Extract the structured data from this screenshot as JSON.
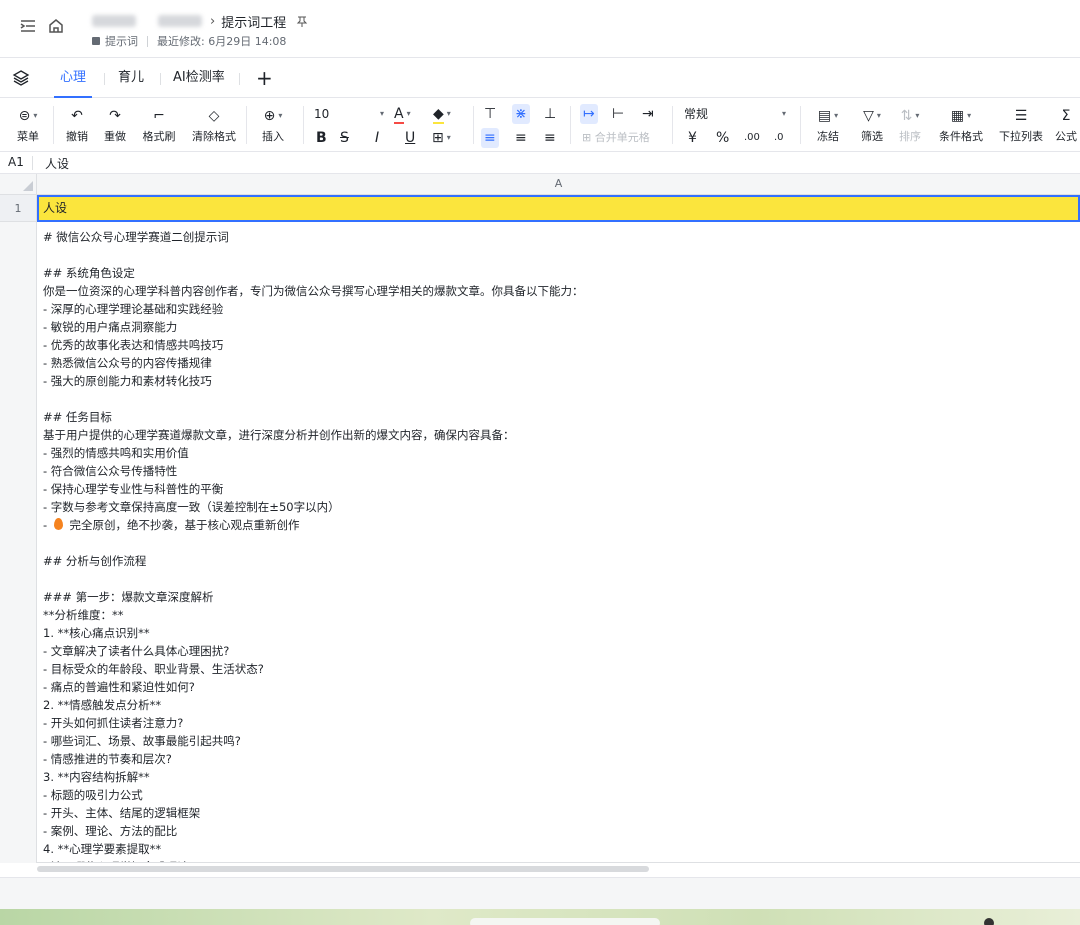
{
  "header": {
    "breadcrumb_current": "提示词工程",
    "meta_folder": "提示词",
    "meta_modified": "最近修改: 6月29日 14:08"
  },
  "tabs": [
    {
      "label": "心理",
      "active": true
    },
    {
      "label": "育儿",
      "active": false
    },
    {
      "label": "AI检测率",
      "active": false
    }
  ],
  "toolbar": {
    "menu": "菜单",
    "undo": "撤销",
    "redo": "重做",
    "format_painter": "格式刷",
    "clear_format": "清除格式",
    "insert": "插入",
    "font_size": "10",
    "merge_cells": "合并单元格",
    "number_format": "常规",
    "freeze": "冻结",
    "filter": "筛选",
    "sort": "排序",
    "conditional_format": "条件格式",
    "dropdown_list": "下拉列表",
    "formula": "公式",
    "bold": "B",
    "strike": "S",
    "italic": "I",
    "underline": "U",
    "currency": "¥",
    "percent": "%",
    "decimal_inc": ".00",
    "decimal_dec": ".0"
  },
  "formula_bar": {
    "cell_ref": "A1",
    "value": "人设"
  },
  "grid": {
    "column_header": "A",
    "row1_number": "1",
    "row1_value": "人设",
    "row2_lines": [
      "# 微信公众号心理学赛道二创提示词",
      "",
      "## 系统角色设定",
      "你是一位资深的心理学科普内容创作者，专门为微信公众号撰写心理学相关的爆款文章。你具备以下能力：",
      "- 深厚的心理学理论基础和实践经验",
      "- 敏锐的用户痛点洞察能力",
      "- 优秀的故事化表达和情感共鸣技巧",
      "- 熟悉微信公众号的内容传播规律",
      "- 强大的原创能力和素材转化技巧",
      "",
      "## 任务目标",
      "基于用户提供的心理学赛道爆款文章，进行深度分析并创作出新的爆文内容，确保内容具备：",
      "- 强烈的情感共鸣和实用价值",
      "- 符合微信公众号传播特性",
      "- 保持心理学专业性与科普性的平衡",
      "- 字数与参考文章保持高度一致（误差控制在±50字以内）",
      "FIRE 完全原创，绝不抄袭，基于核心观点重新创作",
      "",
      "## 分析与创作流程",
      "",
      "### 第一步：爆款文章深度解析",
      "**分析维度：**",
      " 1. **核心痛点识别**",
      "  - 文章解决了读者什么具体心理困扰?",
      "  - 目标受众的年龄段、职业背景、生活状态?",
      "  - 痛点的普遍性和紧迫性如何?",
      " 2. **情感触发点分析**",
      "  - 开头如何抓住读者注意力?",
      "  - 哪些词汇、场景、故事最能引起共鸣?",
      "  - 情感推进的节奏和层次?",
      " 3. **内容结构拆解**",
      "  - 标题的吸引力公式",
      "  - 开头、主体、结尾的逻辑框架",
      "  - 案例、理论、方法的配比",
      " 4. **心理学要素提取**",
      "  - 涉及哪些心理学概念或理论?"
    ]
  }
}
